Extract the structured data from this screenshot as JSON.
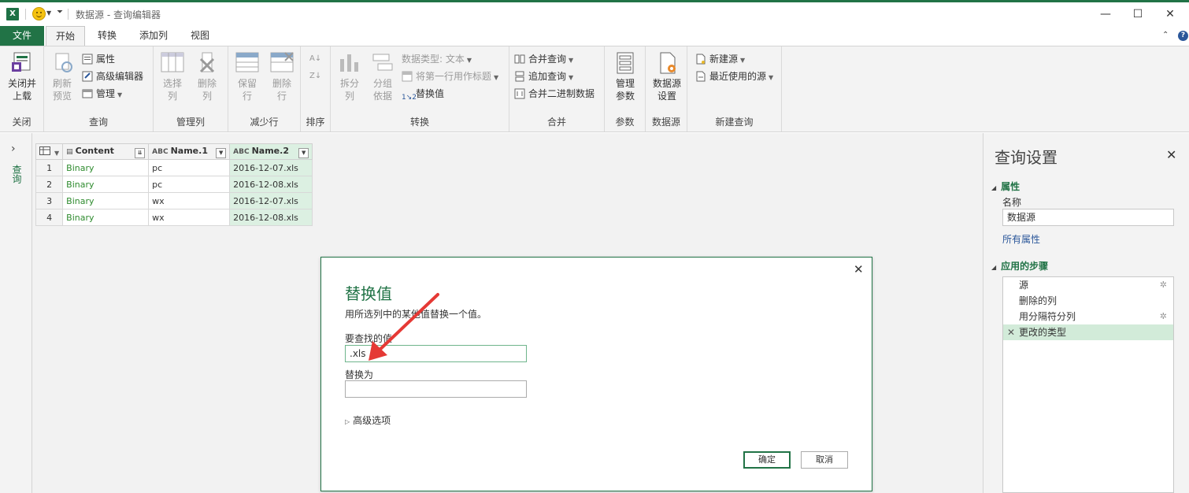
{
  "app": {
    "title": "数据源 - 查询编辑器",
    "logo_letter": "X"
  },
  "tabs": {
    "file": "文件",
    "items": [
      "开始",
      "转换",
      "添加列",
      "视图"
    ],
    "active": "开始"
  },
  "ribbon": {
    "close_group": {
      "button": "关闭并\n上载",
      "label": "关闭"
    },
    "query_group": {
      "refresh": "刷新\n预览",
      "properties": "属性",
      "advanced_editor": "高级编辑器",
      "manage": "管理",
      "label": "查询"
    },
    "manage_cols_group": {
      "choose_cols": "选择\n列",
      "remove_cols": "删除\n列",
      "label": "管理列"
    },
    "reduce_rows_group": {
      "keep_rows": "保留\n行",
      "remove_rows": "删除\n行",
      "label": "减少行"
    },
    "sort_group": {
      "label": "排序"
    },
    "transform_group": {
      "split_col": "拆分\n列",
      "group_by": "分组\n依据",
      "data_type": "数据类型: 文本",
      "first_row_header": "将第一行用作标题",
      "replace_values": "替换值",
      "label": "转换"
    },
    "combine_group": {
      "merge": "合并查询",
      "append": "追加查询",
      "combine_binaries": "合并二进制数据",
      "label": "合并"
    },
    "params_group": {
      "manage_params": "管理\n参数",
      "label": "参数"
    },
    "datasource_group": {
      "settings": "数据源\n设置",
      "label": "数据源"
    },
    "newquery_group": {
      "new_source": "新建源",
      "recent_sources": "最近使用的源",
      "label": "新建查询"
    }
  },
  "leftnav": {
    "label": "查询"
  },
  "grid": {
    "columns": [
      {
        "name": "Content",
        "type": "table"
      },
      {
        "name": "Name.1",
        "type": "ABC"
      },
      {
        "name": "Name.2",
        "type": "ABC"
      }
    ],
    "rows": [
      [
        "1",
        "Binary",
        "pc",
        "2016-12-07.xls"
      ],
      [
        "2",
        "Binary",
        "pc",
        "2016-12-08.xls"
      ],
      [
        "3",
        "Binary",
        "wx",
        "2016-12-07.xls"
      ],
      [
        "4",
        "Binary",
        "wx",
        "2016-12-08.xls"
      ]
    ]
  },
  "query_settings": {
    "title": "查询设置",
    "properties_section": "属性",
    "name_label": "名称",
    "name_value": "数据源",
    "all_properties": "所有属性",
    "steps_section": "应用的步骤",
    "steps": [
      "源",
      "删除的列",
      "用分隔符分列",
      "更改的类型"
    ],
    "selected_step": "更改的类型"
  },
  "dialog": {
    "title": "替换值",
    "description": "用所选列中的某他值替换一个值。",
    "find_label": "要查找的值",
    "find_value": ".xls",
    "replace_label": "替换为",
    "replace_value": "",
    "advanced": "高级选项",
    "ok": "确定",
    "cancel": "取消"
  },
  "colors": {
    "accent": "#217346",
    "selected_col": "#dcf0e2",
    "annotation_arrow": "#e53935"
  }
}
